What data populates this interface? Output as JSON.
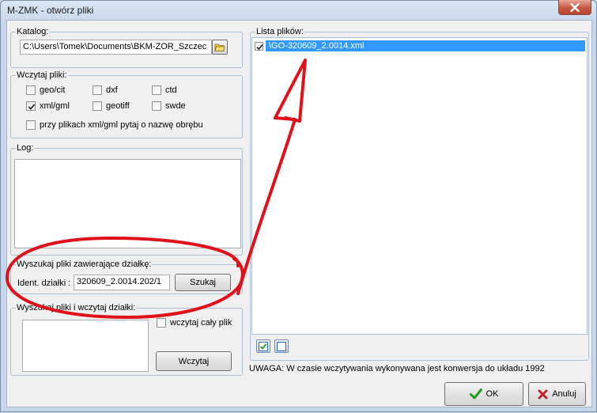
{
  "window": {
    "title": "M-ZMK - otwórz pliki"
  },
  "catalog": {
    "legend": "Katalog:",
    "path": "C:\\Users\\Tomek\\Documents\\BKM-ZOR_Szczec"
  },
  "load_files": {
    "legend": "Wczytaj pliki:",
    "options": [
      {
        "label": "geo/cit",
        "checked": false
      },
      {
        "label": "dxf",
        "checked": false
      },
      {
        "label": "ctd",
        "checked": false
      },
      {
        "label": "xml/gml",
        "checked": true
      },
      {
        "label": "geotiff",
        "checked": false
      },
      {
        "label": "swde",
        "checked": false
      }
    ],
    "ask_label": "przy plikach xml/gml pytaj o nazwę obrębu"
  },
  "log": {
    "legend": "Log:"
  },
  "search": {
    "legend": "Wyszukaj pliki zawierające działkę:",
    "ident_label": "Ident. działki :",
    "ident_value": "320609_2.0014.202/1",
    "button": "Szukaj"
  },
  "load_parcels": {
    "legend": "Wyszukaj pliki i wczytaj działki:",
    "whole_file_label": "wczytaj cały plik",
    "button": "Wczytaj"
  },
  "file_list": {
    "legend": "Lista plików:",
    "items": [
      {
        "name": "\\GO-320609_2.0014.xml",
        "checked": true
      }
    ]
  },
  "note": "UWAGA: W czasie wczytywania wykonywana jest konwersja do układu 1992",
  "footer": {
    "ok": "OK",
    "cancel": "Anuluj"
  },
  "colors": {
    "selection": "#3399ff",
    "annotation": "#e0111b",
    "ok_check": "#1e9e1e",
    "cancel_x": "#c42222"
  }
}
